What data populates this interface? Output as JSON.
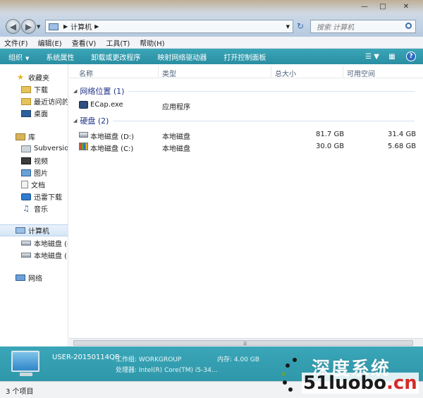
{
  "address": {
    "path": "计算机"
  },
  "search": {
    "placeholder": "搜索 计算机"
  },
  "menu": [
    "文件(F)",
    "编辑(E)",
    "查看(V)",
    "工具(T)",
    "帮助(H)"
  ],
  "toolbar": {
    "organize": "组织",
    "system_properties": "系统属性",
    "uninstall": "卸载或更改程序",
    "map_drive": "映射网络驱动器",
    "control_panel": "打开控制面板"
  },
  "sidebar": {
    "favorites": "收藏夹",
    "downloads": "下载",
    "recent": "最近访问的",
    "desktop": "桌面",
    "libraries": "库",
    "subversion": "Subversion",
    "videos": "视频",
    "pictures": "图片",
    "documents": "文档",
    "thunder": "迅雷下载",
    "music": "音乐",
    "computer": "计算机",
    "drive_c": "本地磁盘 (C",
    "drive_d": "本地磁盘 (D",
    "network": "网络"
  },
  "columns": {
    "name": "名称",
    "type": "类型",
    "total": "总大小",
    "free": "可用空间"
  },
  "groups": {
    "network_location": "网络位置 (1)",
    "hard_disks": "硬盘 (2)"
  },
  "network_items": [
    {
      "name": "ECap.exe",
      "type": "应用程序"
    }
  ],
  "disks": [
    {
      "name": "本地磁盘 (D:)",
      "type": "本地磁盘",
      "total": "81.7 GB",
      "free": "31.4 GB"
    },
    {
      "name": "本地磁盘 (C:)",
      "type": "本地磁盘",
      "total": "30.0 GB",
      "free": "5.68 GB"
    }
  ],
  "details": {
    "pc_name": "USER-20150114QB",
    "workgroup": "工作组: WORKGROUP",
    "memory": "内存: 4.00 GB",
    "processor": "处理器: Intel(R) Core(TM) i5-34..."
  },
  "status": {
    "count": "3 个项目"
  },
  "watermark": {
    "top": "深度系统",
    "url_main": "51luobo",
    "url_tail": ".cn"
  },
  "colors": {
    "accent": "#2f97aa",
    "group_text": "#1e3287"
  }
}
